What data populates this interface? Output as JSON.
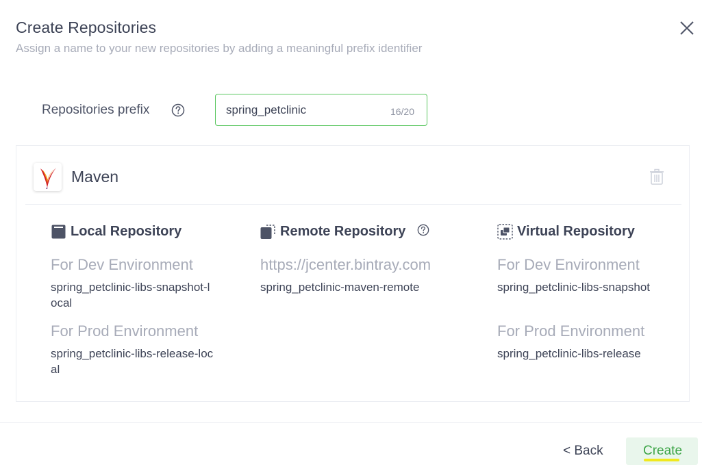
{
  "dialog": {
    "title": "Create Repositories",
    "subtitle": "Assign a name to your new repositories by adding a meaningful prefix identifier"
  },
  "prefix": {
    "label": "Repositories prefix",
    "value": "spring_petclinic",
    "counter": "16/20"
  },
  "package": {
    "name": "Maven",
    "icon": "apache-feather-icon"
  },
  "columns": {
    "local": {
      "title": "Local Repository",
      "dev_label": "For Dev Environment",
      "dev_name": "spring_petclinic-libs-snapshot-local",
      "prod_label": "For Prod Environment",
      "prod_name": "spring_petclinic-libs-release-local"
    },
    "remote": {
      "title": "Remote Repository",
      "url": "https://jcenter.bintray.com",
      "name": "spring_petclinic-maven-remote"
    },
    "virtual": {
      "title": "Virtual Repository",
      "dev_label": "For Dev Environment",
      "dev_name": "spring_petclinic-libs-snapshot",
      "prod_label": "For Prod Environment",
      "prod_name": "spring_petclinic-libs-release"
    }
  },
  "footer": {
    "back_label": "< Back",
    "create_label": "Create"
  },
  "colors": {
    "accent_green": "#58c65e",
    "create_bg": "#e9f6ec",
    "text_dark": "#3d4356",
    "text_muted": "#a7abb8"
  }
}
